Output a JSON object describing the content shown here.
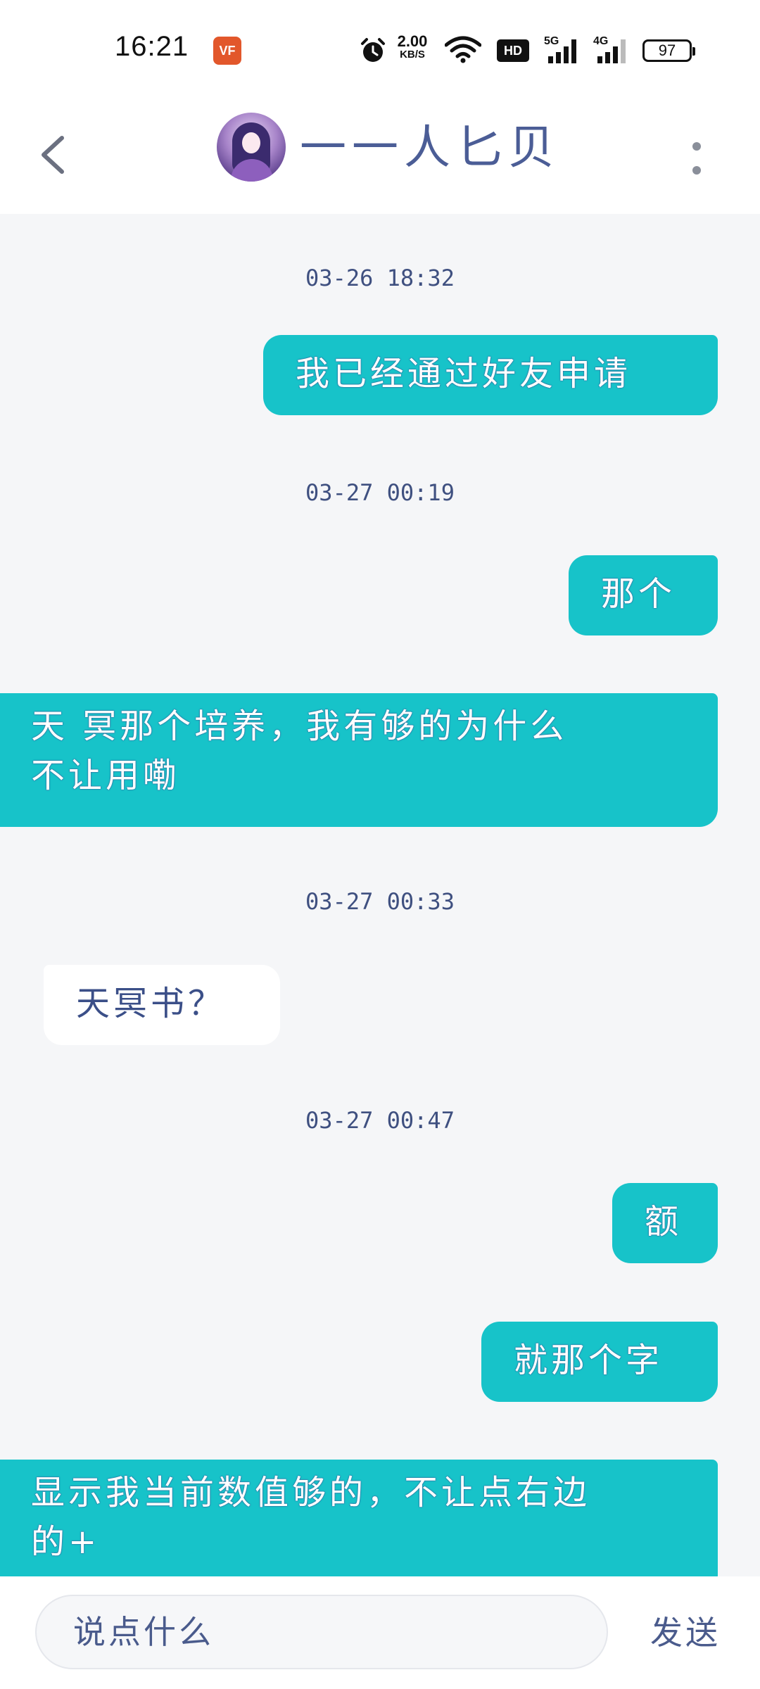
{
  "status_bar": {
    "time": "16:21",
    "app_icon_label": "VF",
    "net_speed_value": "2.00",
    "net_speed_unit": "KB/S",
    "hd_label": "HD",
    "net1_label": "5G",
    "net2_label": "4G",
    "battery": "97"
  },
  "header": {
    "contact_name": "一一人匕贝",
    "back_icon": "chevron-left-icon",
    "more_icon": "more-vertical-icon"
  },
  "chat": {
    "timestamps": [
      "03-26 18:32",
      "03-27 00:19",
      "03-27 00:33",
      "03-27 00:47"
    ],
    "messages": [
      {
        "direction": "out",
        "text": "我已经通过好友申请"
      },
      {
        "direction": "out",
        "text": "那个"
      },
      {
        "direction": "out",
        "line1": "天 冥那个培养，我有够的为什么",
        "line2": "不让用嘞"
      },
      {
        "direction": "in",
        "text": "天冥书？"
      },
      {
        "direction": "out",
        "text": "额"
      },
      {
        "direction": "out",
        "text": "就那个字"
      },
      {
        "direction": "out",
        "line1": "显示我当前数值够的，不让点右边",
        "line2": "的+"
      }
    ]
  },
  "input_bar": {
    "placeholder": "说点什么",
    "send_label": "发送"
  },
  "colors": {
    "outgoing_bubble": "#17c3c9",
    "incoming_bubble": "#ffffff",
    "chat_background": "#f5f6f8",
    "text_primary": "#3d4d7a"
  }
}
